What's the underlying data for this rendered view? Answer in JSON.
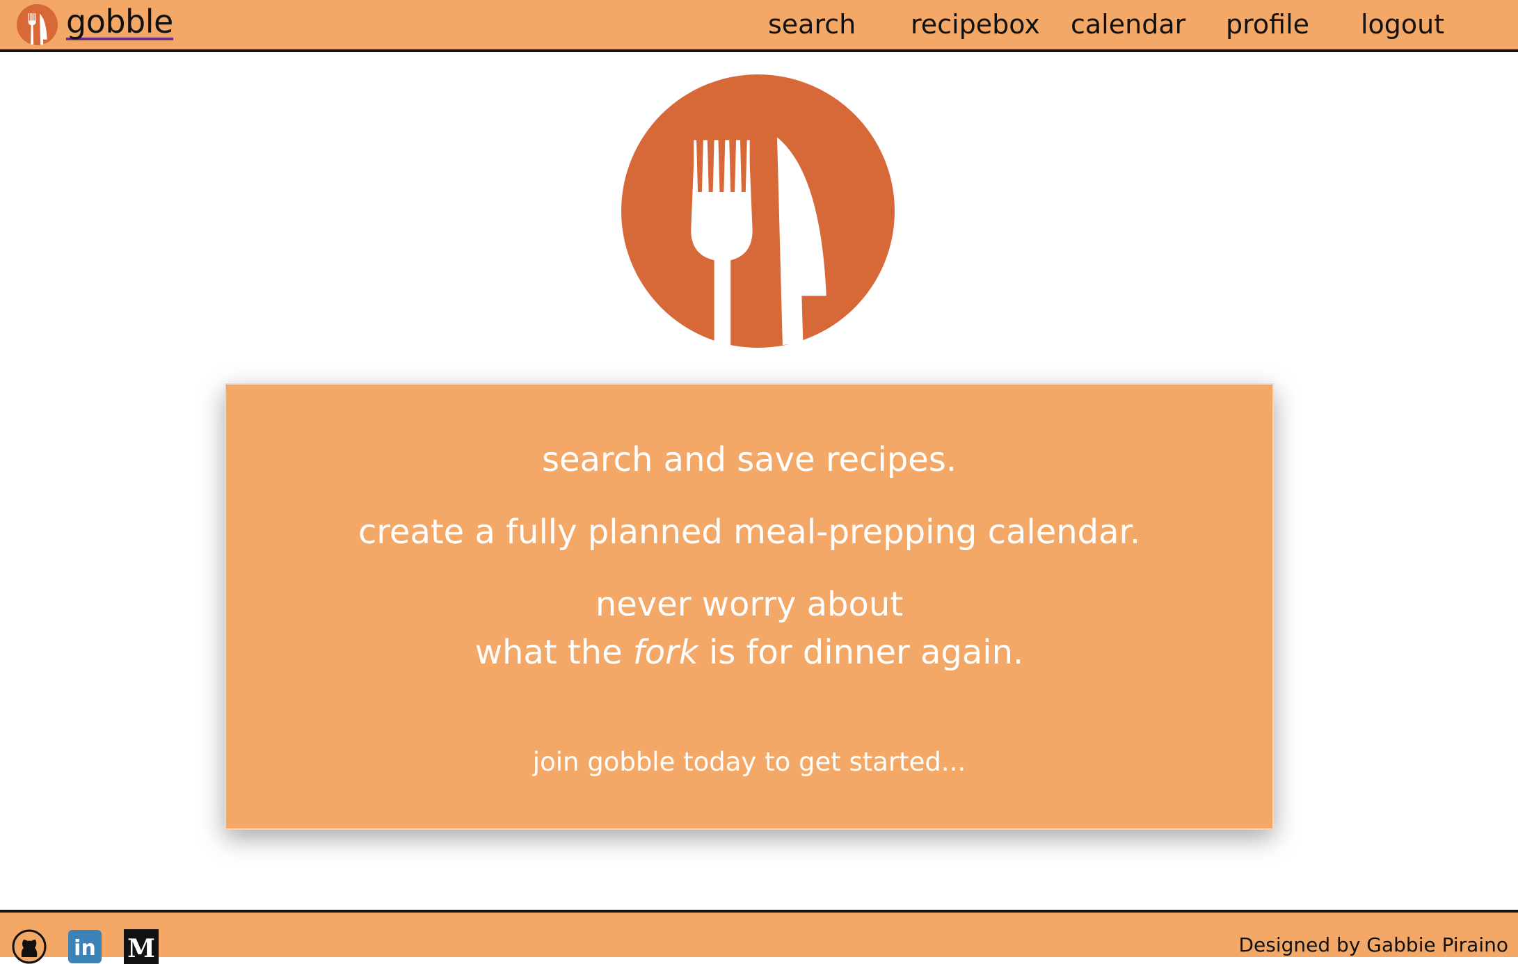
{
  "brand": {
    "name": "gobble",
    "logo_icon": "fork-and-knife-logo-icon"
  },
  "nav": {
    "items": [
      {
        "label": "search"
      },
      {
        "label": "recipebox"
      },
      {
        "label": "calendar"
      },
      {
        "label": "profile"
      },
      {
        "label": "logout"
      }
    ]
  },
  "hero": {
    "logo_icon": "fork-and-knife-logo-icon"
  },
  "card": {
    "line1": "search and save recipes.",
    "line2": "create a fully planned meal-prepping calendar.",
    "line3": "never worry about",
    "line4_before": "what the",
    "line4_em": "fork",
    "line4_after": "is for dinner again.",
    "cta": "join gobble today to get started..."
  },
  "footer": {
    "links": [
      {
        "icon": "github-icon"
      },
      {
        "icon": "linkedin-icon",
        "text": "in"
      },
      {
        "icon": "medium-icon",
        "text": "M"
      }
    ],
    "credit": "Designed by Gabbie Piraino"
  },
  "colors": {
    "accent": "#f3a867",
    "logo_orange": "#d76838",
    "text_dark": "#111111",
    "text_light": "#ffffff",
    "link_underline": "#6a2e8a"
  }
}
